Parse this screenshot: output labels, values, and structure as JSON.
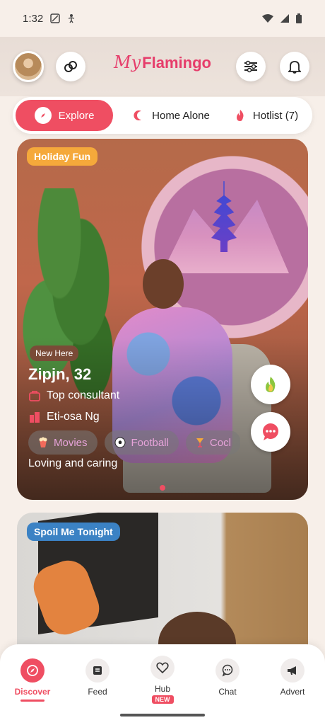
{
  "status_bar": {
    "time": "1:32"
  },
  "header": {
    "logo_my": "My",
    "logo_flamingo": "Flamingo"
  },
  "tabs": [
    {
      "label": "Explore",
      "active": true,
      "icon": "compass-icon"
    },
    {
      "label": "Home Alone",
      "icon": "moon-icon"
    },
    {
      "label": "Hotlist (7)",
      "icon": "flame-icon"
    }
  ],
  "card1": {
    "category_badge": "Holiday Fun",
    "new_badge": "New Here",
    "name_age": "Zipjn, 32",
    "occupation": "Top consultant",
    "location": "Eti-osa Ng",
    "interests": [
      {
        "label": "Movies",
        "icon": "popcorn-icon"
      },
      {
        "label": "Football",
        "icon": "soccer-ball-icon"
      },
      {
        "label": "Cocl",
        "icon": "cocktail-icon"
      }
    ],
    "about": "Loving and caring"
  },
  "card2": {
    "category_badge": "Spoil Me Tonight"
  },
  "bottom_nav": [
    {
      "label": "Discover",
      "icon": "compass-icon",
      "active": true
    },
    {
      "label": "Feed",
      "icon": "feed-icon"
    },
    {
      "label": "Hub",
      "icon": "heart-icon",
      "badge": "NEW"
    },
    {
      "label": "Chat",
      "icon": "chat-icon"
    },
    {
      "label": "Advert",
      "icon": "megaphone-icon"
    }
  ],
  "colors": {
    "accent": "#ef4e62",
    "holiday_badge": "#f5a93b",
    "spoil_badge": "#3b82c4"
  }
}
